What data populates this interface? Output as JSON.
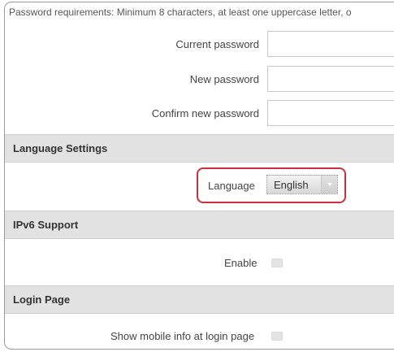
{
  "password": {
    "requirements": "Password requirements: Minimum 8 characters, at least one uppercase letter, o",
    "current_label": "Current password",
    "new_label": "New password",
    "confirm_label": "Confirm new password",
    "current_value": "",
    "new_value": "",
    "confirm_value": ""
  },
  "language_section": {
    "title": "Language Settings",
    "label": "Language",
    "selected": "English",
    "highlight_color": "#c9303e"
  },
  "ipv6_section": {
    "title": "IPv6 Support",
    "enable_label": "Enable",
    "enabled": false
  },
  "login_section": {
    "title": "Login Page",
    "mobile_info_label": "Show mobile info at login page",
    "mobile_info_enabled": false
  }
}
